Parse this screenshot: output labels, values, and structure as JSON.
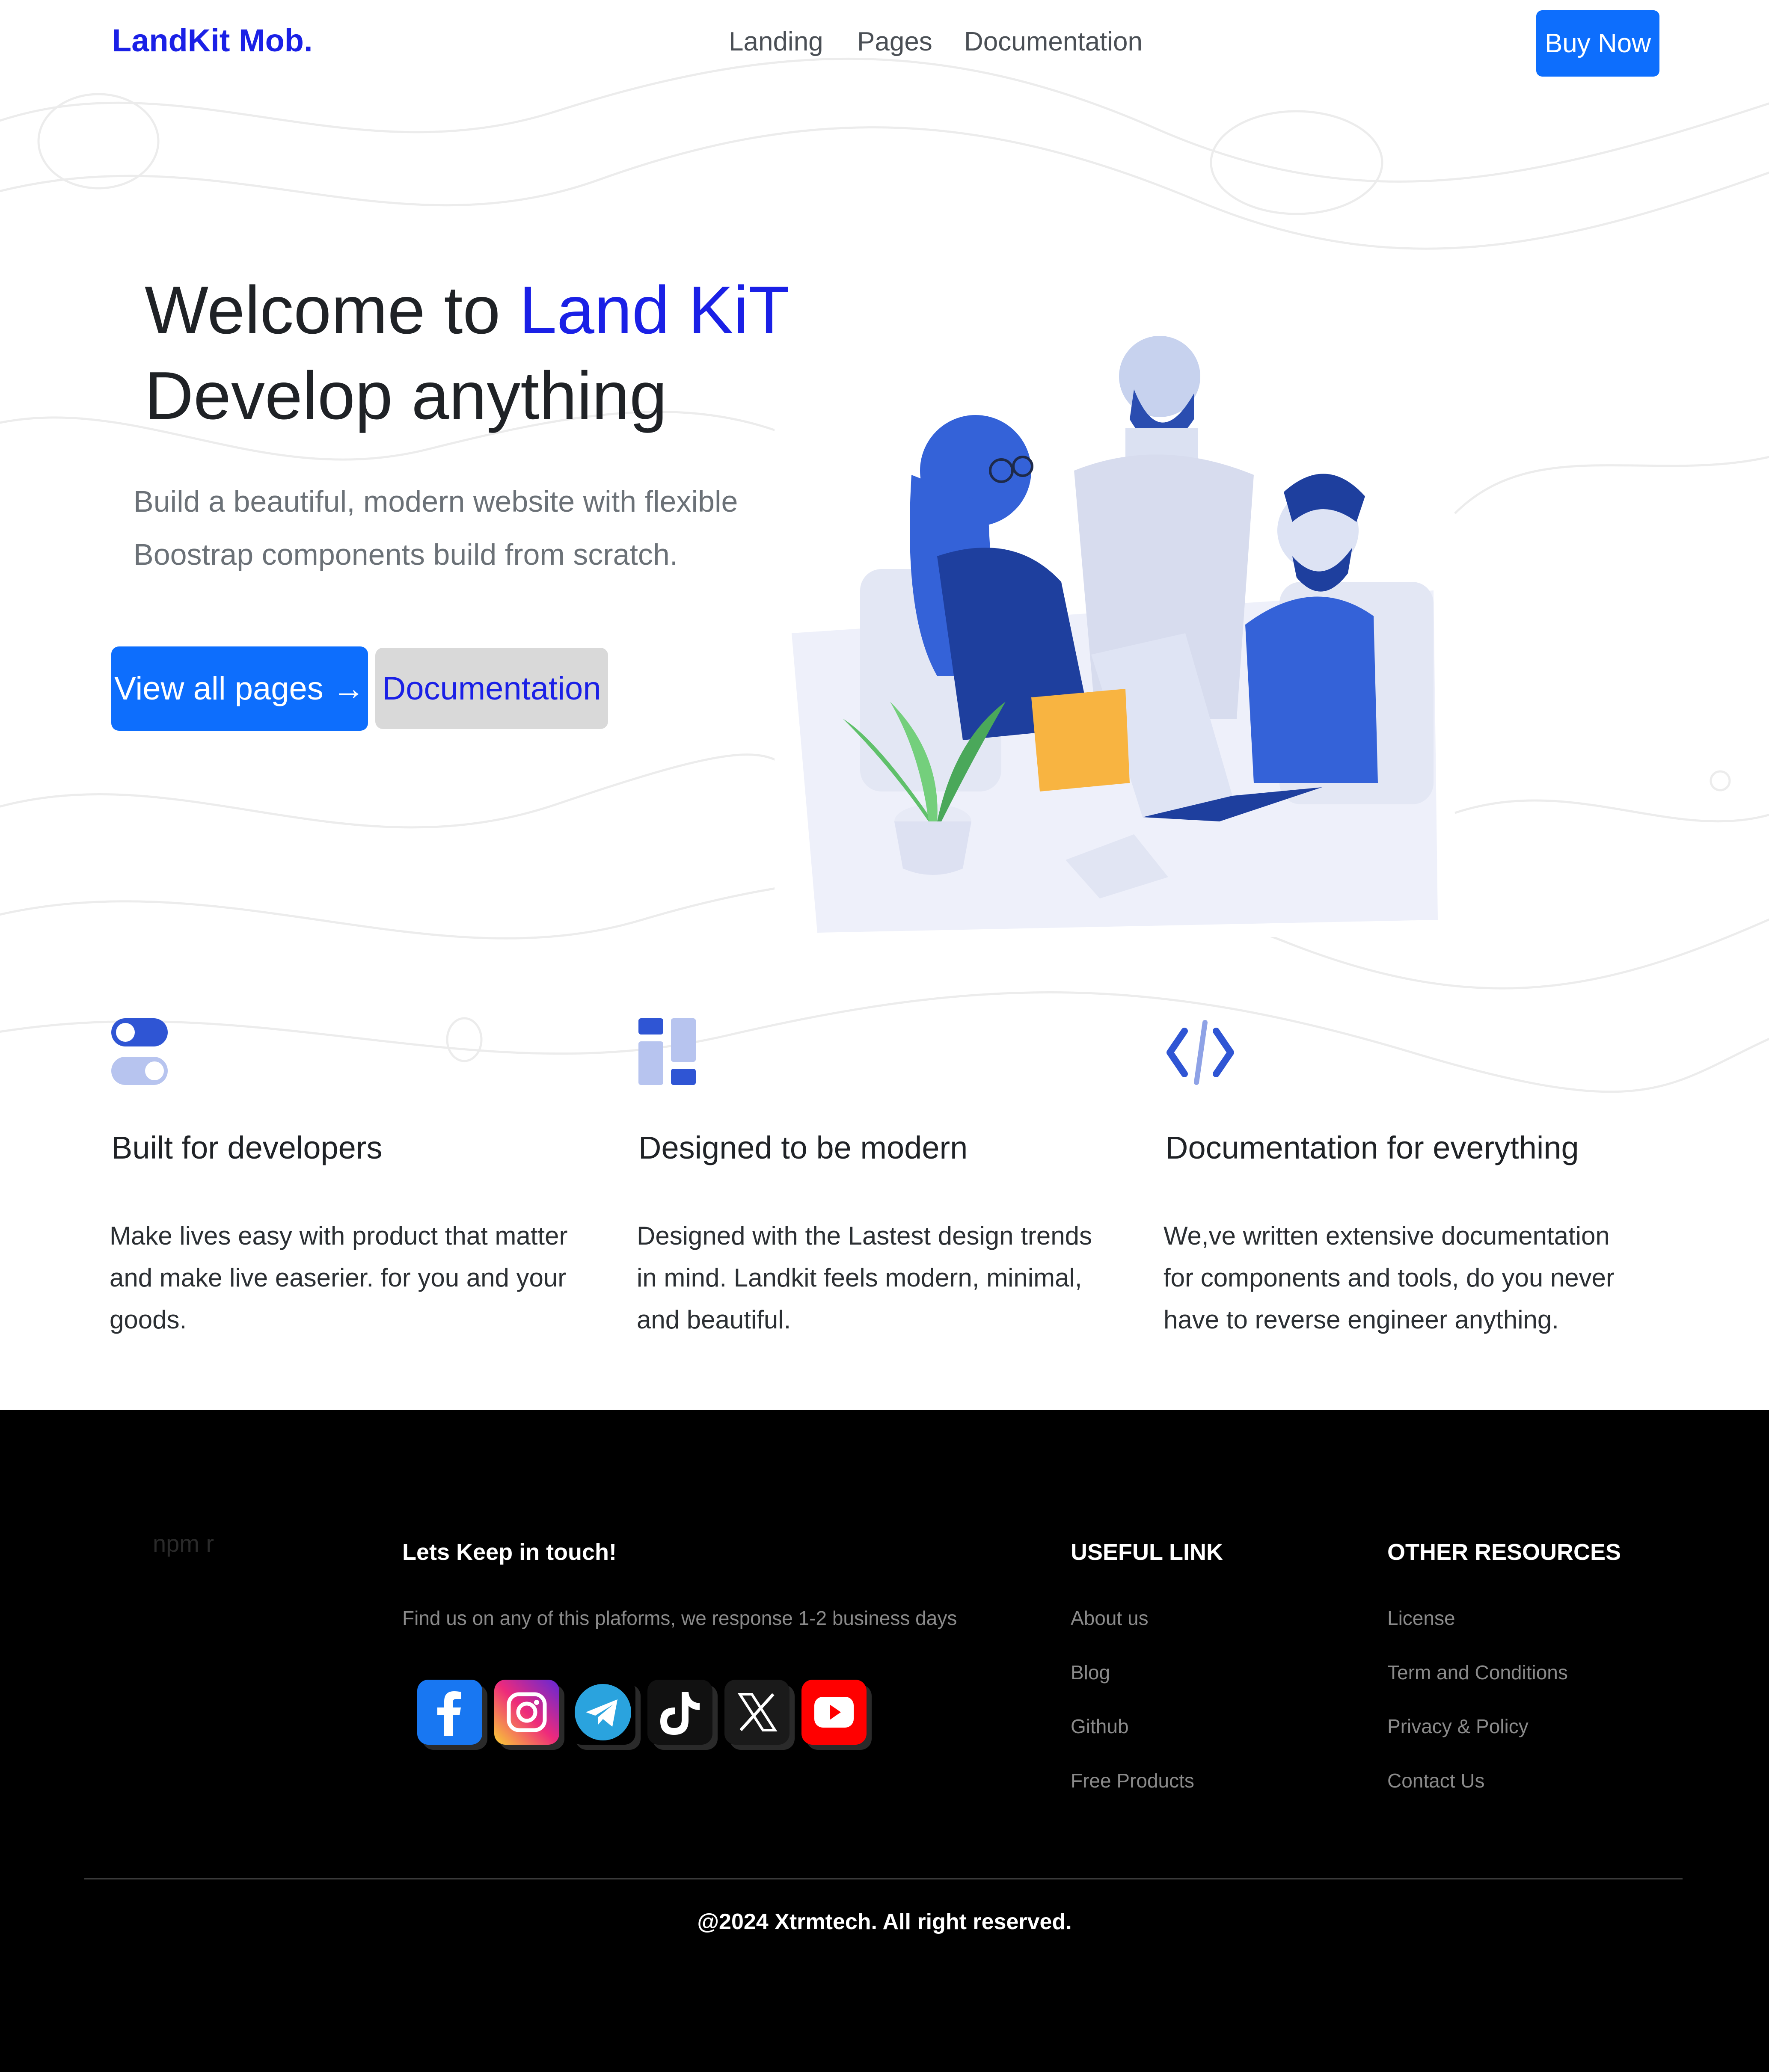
{
  "header": {
    "brand": "LandKit Mob.",
    "nav": [
      "Landing",
      "Pages",
      "Documentation"
    ],
    "buy_label": "Buy Now"
  },
  "hero": {
    "title_prefix": "Welcome to ",
    "title_accent": "Land KiT.",
    "title_line2": "Develop anything",
    "subtitle_line1": "Build a beautiful, modern website with flexible",
    "subtitle_line2": "Boostrap components build from scratch.",
    "primary_button": "View all pages →",
    "secondary_button": "Documentation"
  },
  "features": [
    {
      "icon": "toggle-icon",
      "title": "Built for developers",
      "text": "Make lives easy with product that matter and make live easerier. for you and your goods."
    },
    {
      "icon": "layout-grid-icon",
      "title": "Designed to be modern",
      "text": "Designed with the Lastest design trends in mind. Landkit feels modern, minimal, and beautiful."
    },
    {
      "icon": "code-icon",
      "title": "Documentation for everything",
      "text": "We,ve written extensive documentation for components and tools, do you never have to reverse engineer anything."
    }
  ],
  "footer": {
    "npm_text": "npm r",
    "contact_heading": "Lets Keep in touch!",
    "contact_text": "Find us on any of this plaforms, we response 1-2 business days",
    "social": [
      "facebook-icon",
      "instagram-icon",
      "telegram-icon",
      "tiktok-icon",
      "x-icon",
      "youtube-icon"
    ],
    "useful_heading": "USEFUL LINK",
    "useful_links": [
      "About us",
      "Blog",
      "Github",
      "Free Products"
    ],
    "resources_heading": "OTHER RESOURCES",
    "resource_links": [
      "License",
      "Term and Conditions",
      "Privacy & Policy",
      "Contact Us"
    ],
    "copyright": "@2024 Xtrmtech. All right reserved."
  },
  "colors": {
    "brand": "#1a20e6",
    "primary": "#0d6efd",
    "footer_bg": "#000000"
  }
}
